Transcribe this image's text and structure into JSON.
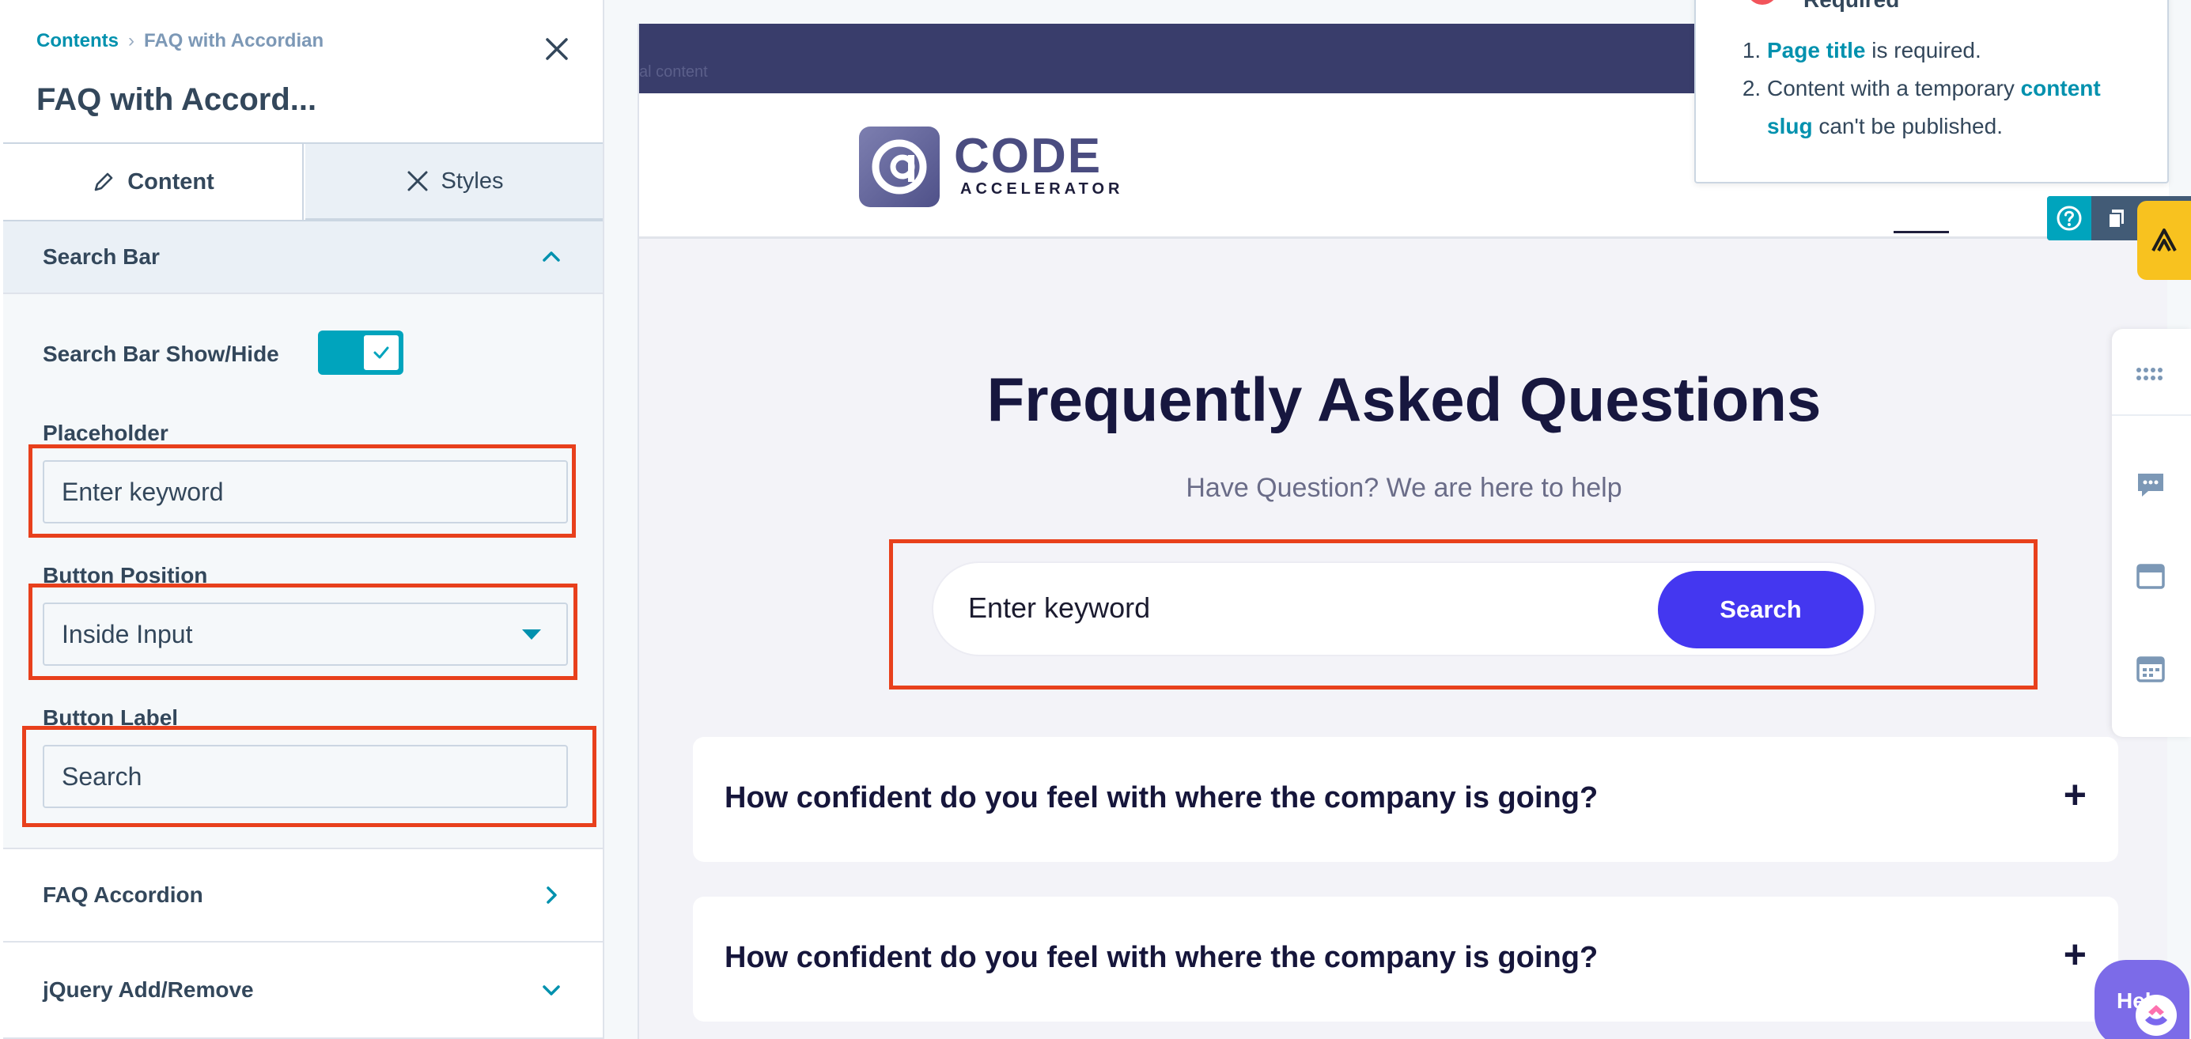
{
  "breadcrumb": {
    "parent": "Contents",
    "current": "FAQ with Accordian"
  },
  "panel_title": "FAQ with Accord...",
  "tabs": {
    "content": "Content",
    "styles": "Styles"
  },
  "search_bar_section": {
    "title": "Search Bar",
    "show_hide_label": "Search Bar Show/Hide",
    "show_hide_on": true,
    "placeholder_label": "Placeholder",
    "placeholder_value": "Enter keyword",
    "button_position_label": "Button Position",
    "button_position_value": "Inside Input",
    "button_label_label": "Button Label",
    "button_label_value": "Search"
  },
  "sections": {
    "faq_accordion": "FAQ Accordion",
    "jquery_add_remove": "jQuery Add/Remove"
  },
  "preview": {
    "topbar_ghost_text": "al content",
    "logo_code": "CODE",
    "logo_sub": "ACCELERATOR",
    "heading": "Frequently Asked Questions",
    "subheading": "Have Question? We are here to help",
    "search_placeholder": "Enter keyword",
    "search_button": "Search",
    "faq_items": [
      "How confident do you feel with where the company is going?",
      "How confident do you feel with where the company is going?"
    ]
  },
  "popover": {
    "title": "Required",
    "item1_link": "Page title",
    "item1_rest": " is required.",
    "item2_pre": "Content with a temporary ",
    "item2_link": "content slug",
    "item2_rest": " can't be published."
  },
  "help_bubble": "Hel",
  "colors": {
    "accent": "#00a4bd",
    "link": "#0091ae",
    "search_button": "#4437f0",
    "highlight": "#e8401c",
    "heading": "#17173f"
  }
}
